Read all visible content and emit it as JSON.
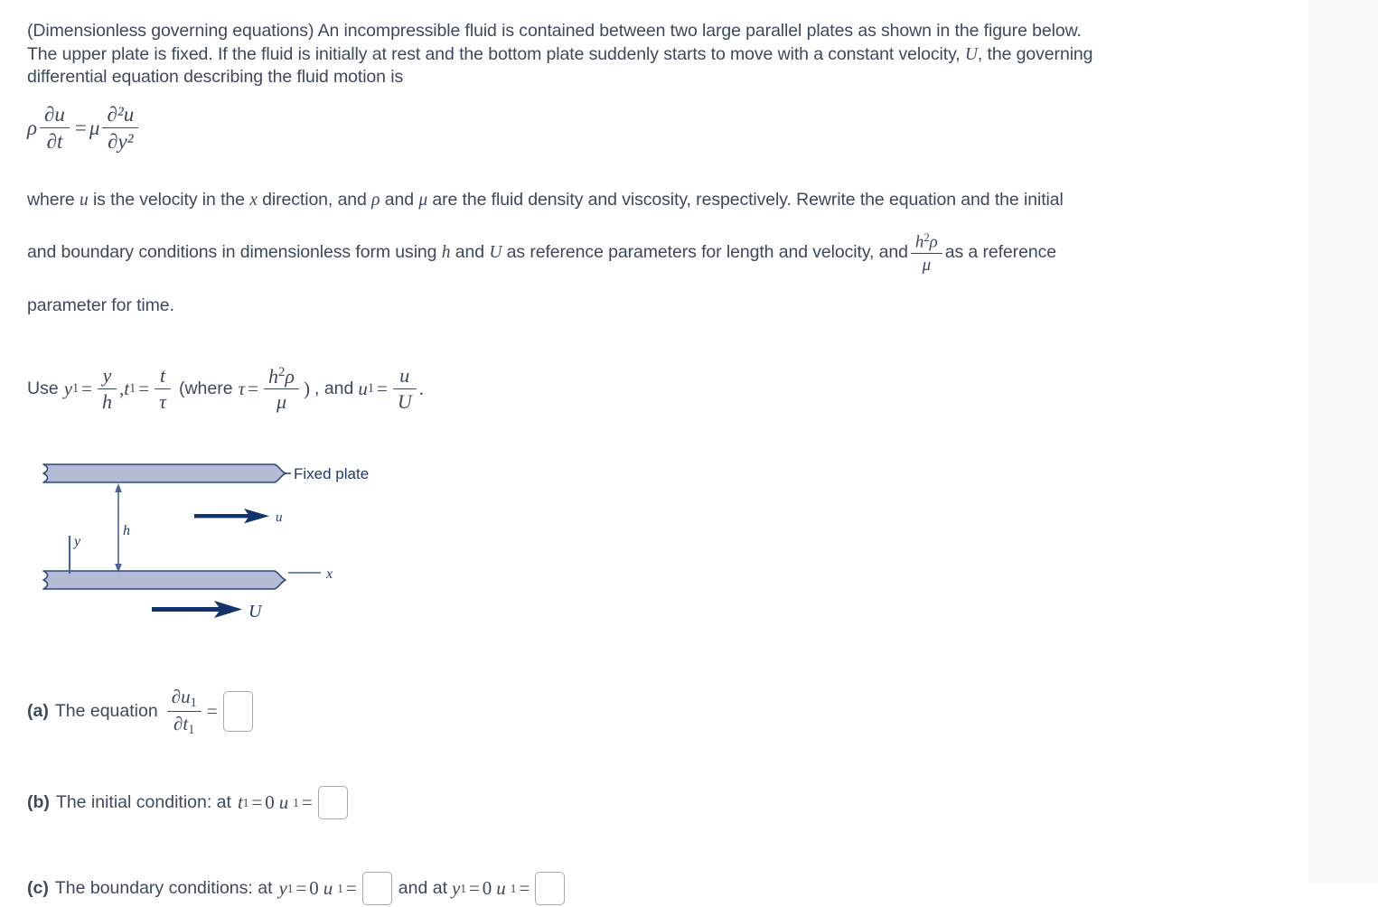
{
  "problem": {
    "intro_line1": "(Dimensionless governing equations) An incompressible fluid is contained between two large parallel plates as shown in the figure below.",
    "intro_line2_a": "The upper plate is fixed. If the fluid is initially at rest and the bottom plate suddenly starts to move with a constant velocity,",
    "intro_line2_U": "U",
    "intro_line2_b": ", the governing",
    "intro_line3": "differential equation describing the fluid motion is",
    "governing_equation": {
      "rho": "ρ",
      "du": "∂u",
      "dt": "∂t",
      "equals": "=",
      "mu": "μ",
      "d2u": "∂²u",
      "dy2": "∂y²"
    },
    "where_line1_a": "where",
    "where_u": "u",
    "where_line1_b": "is the velocity in the",
    "where_x": "x",
    "where_line1_c": "direction, and",
    "where_rho": "ρ",
    "where_line1_d": "and",
    "where_mu": "μ",
    "where_line1_e": "are the fluid density and viscosity, respectively. Rewrite the equation and the initial",
    "where_line2_a": "and boundary conditions in dimensionless form using",
    "where_h": "h",
    "where_line2_b": "and",
    "where_U": "U",
    "where_line2_c": "as reference parameters for length and velocity, and",
    "ref_frac_num_h": "h",
    "ref_frac_num_exp": "2",
    "ref_frac_num_rho": "ρ",
    "ref_frac_den": "μ",
    "where_line2_d": "as a reference",
    "where_line3": "parameter for time.",
    "use_line": {
      "use": "Use",
      "y1": "y",
      "y1_sub": "1",
      "eq1": "=",
      "f1_num": "y",
      "f1_den": "h",
      "comma": ",",
      "t1": "t",
      "t1_sub": "1",
      "eq2": "=",
      "f2_num": "t",
      "f2_den": "τ",
      "where_open": "(where",
      "tau": "τ",
      "eq3": "=",
      "f3_num_h": "h",
      "f3_num_exp": "2",
      "f3_num_rho": "ρ",
      "f3_den": "μ",
      "close_paren": ")",
      "and": ", and",
      "u1": "u",
      "u1_sub": "1",
      "eq4": "=",
      "f4_num": "u",
      "f4_den": "U",
      "period": "."
    }
  },
  "figure": {
    "fixed_plate_label": "Fixed plate",
    "h_label": "h",
    "y_label": "y",
    "x_label": "x",
    "u_label": "u",
    "U_label": "U",
    "colors": {
      "plate_fill": "#b3bcd4",
      "plate_stroke": "#2e4a7d",
      "arrow": "#12346b",
      "dim_line": "#4a6496",
      "text": "#1f3a6e"
    }
  },
  "parts": {
    "a": {
      "marker": "(a)",
      "text": "The equation",
      "frac_num_d": "∂u",
      "frac_num_sub": "1",
      "frac_den_d": "∂t",
      "frac_den_sub": "1",
      "equals": "=",
      "answer": ""
    },
    "b": {
      "marker": "(b)",
      "text": "The initial condition: at",
      "t1": "t",
      "t1_sub": "1",
      "eq1": "=",
      "zero": "0",
      "u1": "u",
      "u1_sub": "1",
      "eq2": "=",
      "answer": ""
    },
    "c": {
      "marker": "(c)",
      "text": "The boundary conditions: at",
      "y1": "y",
      "y1_sub": "1",
      "eq1": "=",
      "zero1": "0",
      "u1": "u",
      "u1_sub": "1",
      "eq2": "=",
      "answer1": "",
      "and_at": "and  at",
      "y1b": "y",
      "y1b_sub": "1",
      "eq3": "=",
      "zero2": "0",
      "u1b": "u",
      "u1b_sub": "1",
      "eq4": "=",
      "answer2": ""
    }
  },
  "theme": {
    "text_color": "#3d4a5c",
    "page_bg": "#ffffff",
    "rail_bg": "#fafafa",
    "box_border": "#a8a8a8"
  }
}
